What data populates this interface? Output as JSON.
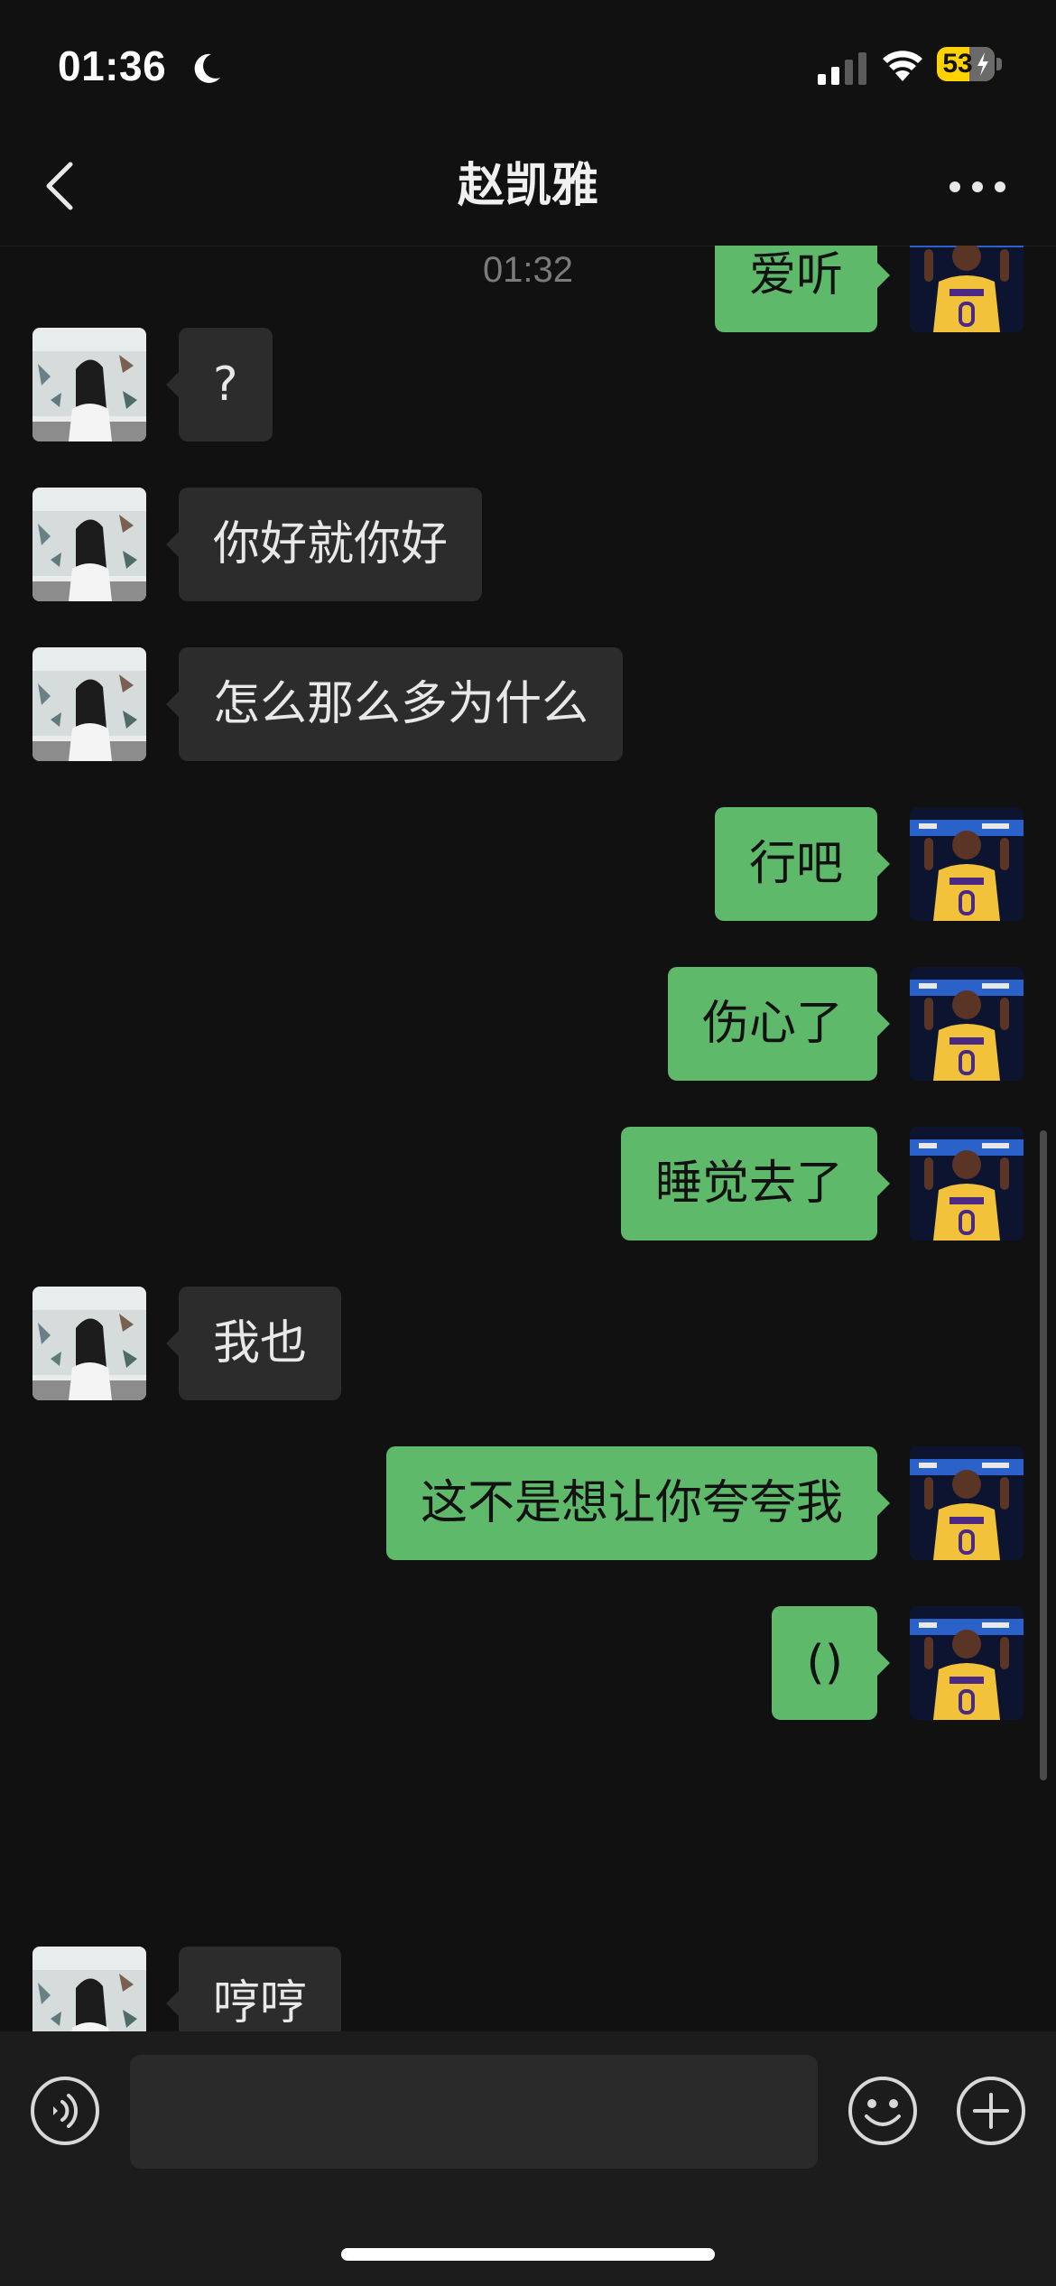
{
  "status_bar": {
    "time": "01:36",
    "battery": "53",
    "moon_icon": "moon-icon",
    "signal_icon": "cellular-signal-icon",
    "wifi_icon": "wifi-icon",
    "battery_icon": "battery-charging-icon"
  },
  "header": {
    "title": "赵凯雅",
    "back_icon": "chevron-left-icon",
    "more_icon": "more-dots-icon"
  },
  "chat": {
    "timestamp": "01:32",
    "messages": [
      {
        "side": "right",
        "text": "爱听"
      },
      {
        "side": "left",
        "text": "?"
      },
      {
        "side": "left",
        "text": "你好就你好"
      },
      {
        "side": "left",
        "text": "怎么那么多为什么"
      },
      {
        "side": "right",
        "text": "行吧"
      },
      {
        "side": "right",
        "text": "伤心了"
      },
      {
        "side": "right",
        "text": "睡觉去了"
      },
      {
        "side": "left",
        "text": "我也"
      },
      {
        "side": "right",
        "text": "这不是想让你夸夸我"
      },
      {
        "side": "right",
        "text": "()"
      },
      {
        "side": "left",
        "text": "哼哼"
      }
    ]
  },
  "input_bar": {
    "value": "",
    "placeholder": "",
    "voice_icon": "voice-icon",
    "emoji_icon": "emoji-icon",
    "plus_icon": "plus-icon"
  },
  "colors": {
    "background": "#111111",
    "bubble_out": "#5fb96b",
    "bubble_in": "#2c2c2c",
    "input_bar": "#1c1c1c"
  }
}
